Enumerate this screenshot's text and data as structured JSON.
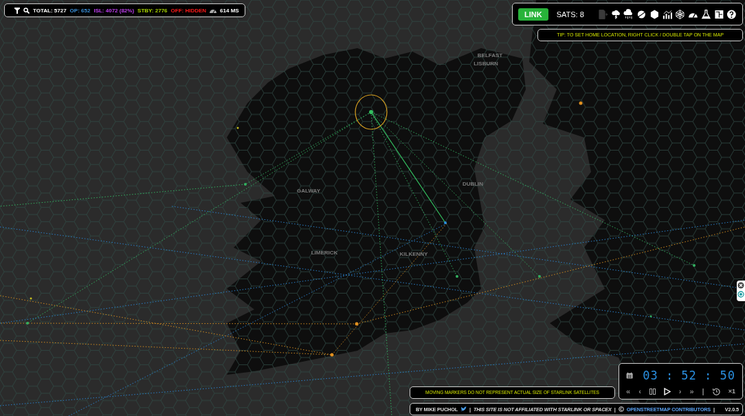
{
  "stats": [
    {
      "text": "TOTAL: 5727",
      "color": "#ffffff"
    },
    {
      "text": "OP: 652",
      "color": "#3a8fd8"
    },
    {
      "text": "ISL: 4072 (82%)",
      "color": "#c040f0"
    },
    {
      "text": "STBY: 2776",
      "color": "#a8d400"
    },
    {
      "text": "OFF: HIDDEN",
      "color": "#ff1a1a"
    }
  ],
  "ping": "614 MS",
  "toolbar": {
    "link_button": "LINK",
    "sats": "SATS: 8",
    "tools": [
      {
        "kind": "export",
        "disabled": true
      },
      {
        "kind": "storm",
        "disabled": false
      },
      {
        "kind": "rain",
        "disabled": false
      },
      {
        "kind": "planet",
        "disabled": false
      },
      {
        "kind": "hexagon",
        "disabled": false
      },
      {
        "kind": "chart",
        "disabled": false
      },
      {
        "kind": "web",
        "disabled": false
      },
      {
        "kind": "gauge",
        "disabled": false
      },
      {
        "kind": "flask",
        "disabled": false
      },
      {
        "kind": "layout",
        "disabled": false
      },
      {
        "kind": "help",
        "disabled": false
      }
    ]
  },
  "tip": "TIP: TO SET HOME LOCATION, RIGHT CLICK / DOUBLE TAP ON THE MAP",
  "map_labels": [
    "BELFAST",
    "LISBURN",
    "DUBLIN",
    "GALWAY",
    "LIMERICK",
    "KILKENNY"
  ],
  "notice": "MOVING MARKERS DO NOT REPRESENT ACTUAL SIZE OF STARLINK SATELLITES",
  "clock": {
    "time": "03 : 52 : 50",
    "controls": [
      "«",
      "‹",
      "›",
      "»",
      "|"
    ],
    "speed": "×1"
  },
  "footer": {
    "author": "BY MIKE PUCHOL",
    "disclaimer": "THIS SITE IS NOT AFFILIATED WITH STARLINK OR SPACEX",
    "credit": "OPENSTREETMAP CONTRIBUTORS",
    "version": "V2.0.5",
    "separator": "|"
  }
}
